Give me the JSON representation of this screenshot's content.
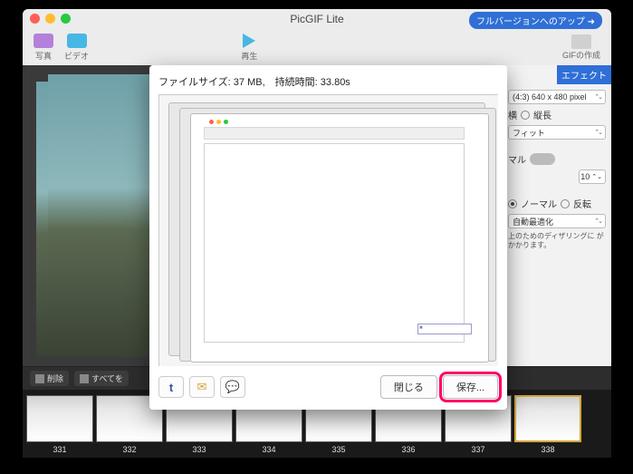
{
  "window": {
    "title": "PicGIF Lite",
    "upgrade": "フルバージョンへのアップ ➜"
  },
  "toolbar": {
    "photo": "写真",
    "video": "ビデオ",
    "play": "再生",
    "create": "GIFの作成"
  },
  "sidebar": {
    "tab_effect": "エフェクト",
    "size_label": "(4:3) 640 x 480 pixel",
    "aspect_a": "横",
    "aspect_b": "縦長",
    "fit": "フィット",
    "mode": "マル",
    "fps_value": "10",
    "loop_normal": "ノーマル",
    "loop_reverse": "反転",
    "opt": "自動最適化",
    "note": "上のためのディザリングに\nがかかります。"
  },
  "timeline": {
    "delete": "削除",
    "select_all": "すべてを",
    "frames": [
      "331",
      "332",
      "333",
      "334",
      "335",
      "336",
      "337",
      "338"
    ],
    "selected": "338"
  },
  "modal": {
    "filesize_label": "ファイルサイズ:",
    "filesize": "37 MB",
    "duration_label": "持続時間:",
    "duration": "33.80s",
    "close": "閉じる",
    "save": "保存...",
    "share": {
      "tumblr": "t",
      "mail": "✉",
      "msg": "💬"
    }
  }
}
